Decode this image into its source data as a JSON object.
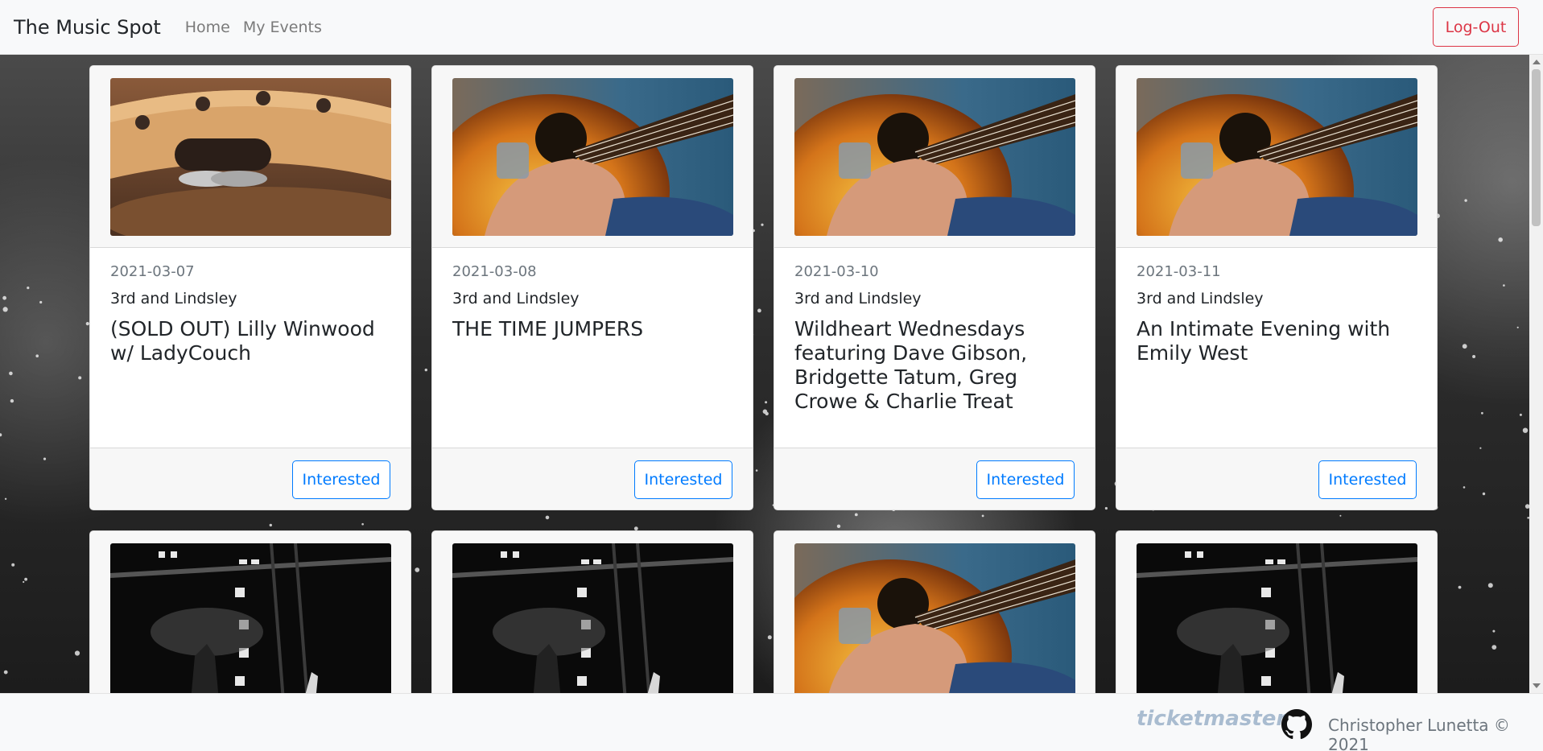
{
  "nav": {
    "brand": "The Music Spot",
    "links": [
      {
        "label": "Home"
      },
      {
        "label": "My Events"
      }
    ],
    "logout_label": "Log-Out"
  },
  "events": [
    {
      "date": "2021-03-07",
      "venue": "3rd and Lindsley",
      "title": "(SOLD OUT) Lilly Winwood w/ LadyCouch",
      "image": "tambourine",
      "button": "Interested"
    },
    {
      "date": "2021-03-08",
      "venue": "3rd and Lindsley",
      "title": "THE TIME JUMPERS",
      "image": "guitar",
      "button": "Interested"
    },
    {
      "date": "2021-03-10",
      "venue": "3rd and Lindsley",
      "title": "Wildheart Wednesdays featuring Dave Gibson, Bridgette Tatum, Greg Crowe & Charlie Treat",
      "image": "guitar",
      "button": "Interested"
    },
    {
      "date": "2021-03-11",
      "venue": "3rd and Lindsley",
      "title": "An Intimate Evening with Emily West",
      "image": "guitar",
      "button": "Interested"
    },
    {
      "image": "concert-stage"
    },
    {
      "image": "concert-stage"
    },
    {
      "image": "guitar"
    },
    {
      "image": "concert-stage"
    }
  ],
  "footer": {
    "partner_logo": "ticketmaster",
    "github_icon": "github-icon",
    "copyright": "Christopher Lunetta © 2021"
  },
  "colors": {
    "logout": "#dc3545",
    "interested": "#007bff",
    "navbar_bg": "#f8f9fa"
  }
}
